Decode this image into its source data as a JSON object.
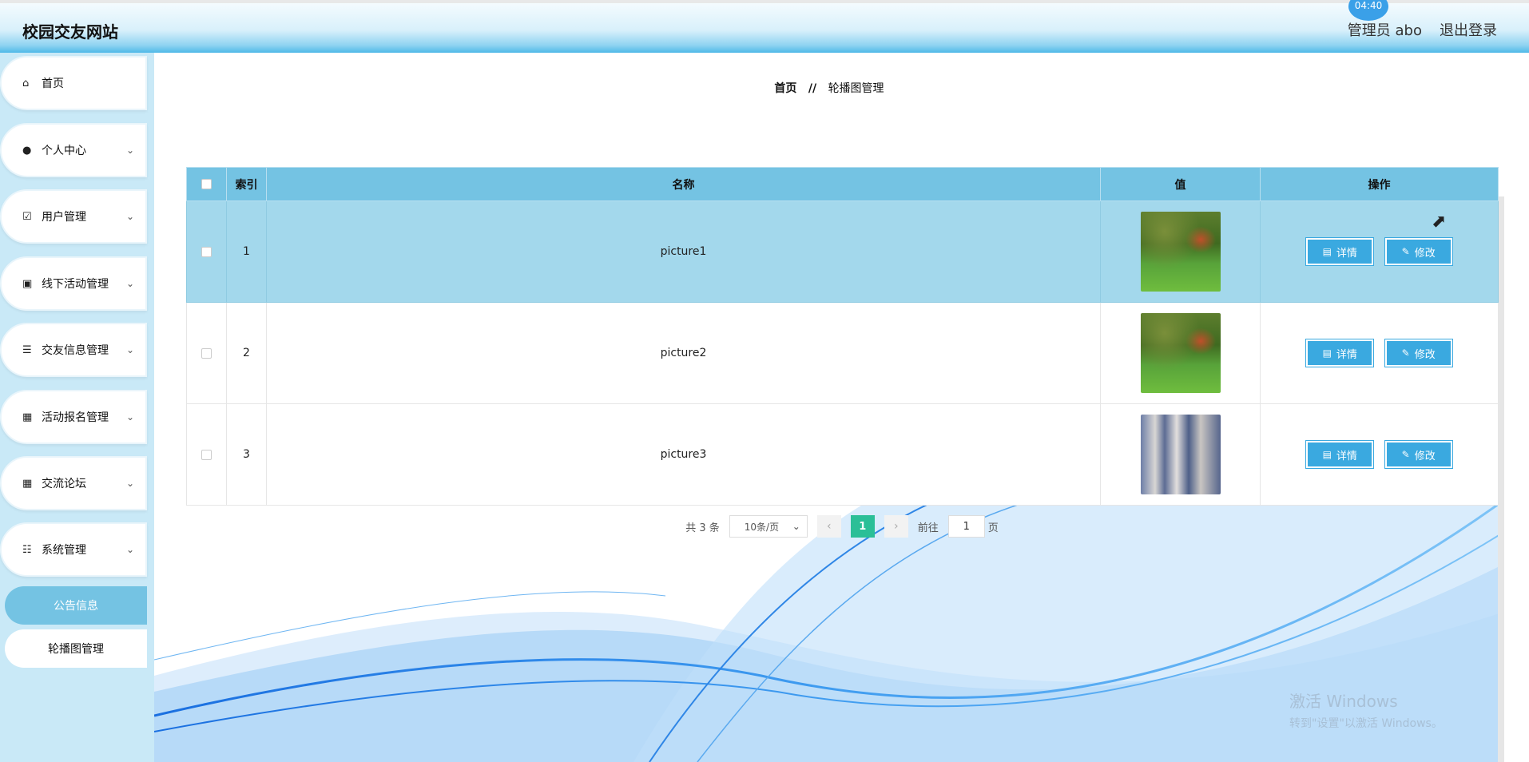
{
  "header": {
    "site_title": "校园交友网站",
    "user_label": "管理员 abo",
    "logout_label": "退出登录",
    "clock_text": "04:40"
  },
  "sidebar": {
    "items": [
      {
        "label": "首页",
        "icon": "home-icon"
      },
      {
        "label": "个人中心",
        "icon": "user-icon"
      },
      {
        "label": "用户管理",
        "icon": "clipboard-icon"
      },
      {
        "label": "线下活动管理",
        "icon": "briefcase-icon"
      },
      {
        "label": "交友信息管理",
        "icon": "list-icon"
      },
      {
        "label": "活动报名管理",
        "icon": "grid-icon"
      },
      {
        "label": "交流论坛",
        "icon": "grid-icon"
      },
      {
        "label": "系统管理",
        "icon": "sliders-icon"
      }
    ],
    "sub_items": [
      {
        "label": "公告信息"
      },
      {
        "label": "轮播图管理"
      }
    ]
  },
  "breadcrumb": {
    "home": "首页",
    "separator": "//",
    "current": "轮播图管理"
  },
  "table": {
    "columns": [
      "索引",
      "名称",
      "值",
      "操作"
    ],
    "rows": [
      {
        "index": "1",
        "name": "picture1",
        "image": "green-park-thumbnail"
      },
      {
        "index": "2",
        "name": "picture2",
        "image": "green-park-thumbnail"
      },
      {
        "index": "3",
        "name": "picture3",
        "image": "blurred-blue-thumbnail"
      }
    ],
    "detail_label": "详情",
    "edit_label": "修改"
  },
  "pagination": {
    "total_text": "共 3 条",
    "page_size": "10条/页",
    "current_page": "1",
    "goto_prefix": "前往",
    "goto_value": "1",
    "goto_suffix": "页"
  },
  "watermark": {
    "line1": "激活 Windows",
    "line2": "转到\"设置\"以激活 Windows。"
  },
  "colors": {
    "accent": "#74c3e3",
    "button": "#3aa9e0",
    "page_active": "#2bbf97"
  }
}
